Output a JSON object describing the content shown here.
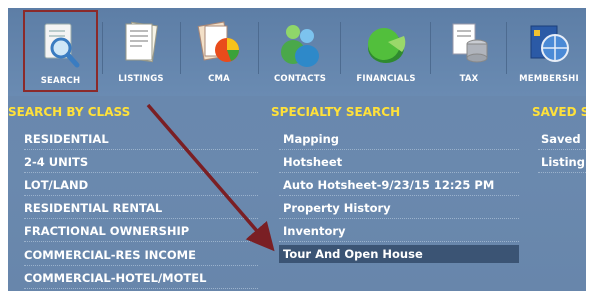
{
  "toolbar": {
    "items": [
      {
        "label": "SEARCH",
        "icon": "search-document-icon",
        "selected": true
      },
      {
        "label": "LISTINGS",
        "icon": "listings-document-icon"
      },
      {
        "label": "CMA",
        "icon": "cma-chart-icon"
      },
      {
        "label": "CONTACTS",
        "icon": "contacts-people-icon"
      },
      {
        "label": "FINANCIALS",
        "icon": "financials-pie-icon"
      },
      {
        "label": "TAX",
        "icon": "tax-database-icon"
      },
      {
        "label": "MEMBERSHI",
        "icon": "membership-globe-icon"
      }
    ]
  },
  "search_by_class": {
    "heading": "SEARCH BY CLASS",
    "items": [
      "RESIDENTIAL",
      "2-4 UNITS",
      "LOT/LAND",
      "RESIDENTIAL RENTAL",
      "FRACTIONAL OWNERSHIP",
      "COMMERCIAL-RES INCOME",
      "COMMERCIAL-HOTEL/MOTEL"
    ]
  },
  "specialty_search": {
    "heading": "SPECIALTY SEARCH",
    "items": [
      "Mapping",
      "Hotsheet",
      "Auto Hotsheet-9/23/15 12:25 PM",
      "Property History",
      "Inventory",
      "Tour And Open House"
    ],
    "highlighted": "Tour And Open House"
  },
  "saved_search": {
    "heading": "SAVED S",
    "items": [
      "Saved",
      "Listing"
    ]
  },
  "colors": {
    "panel_bg": "#6a89ae",
    "heading": "#ffe13a",
    "selected_border": "#8b2a2a",
    "arrow": "#7a1f24",
    "highlight_bg": "#3b5474"
  }
}
